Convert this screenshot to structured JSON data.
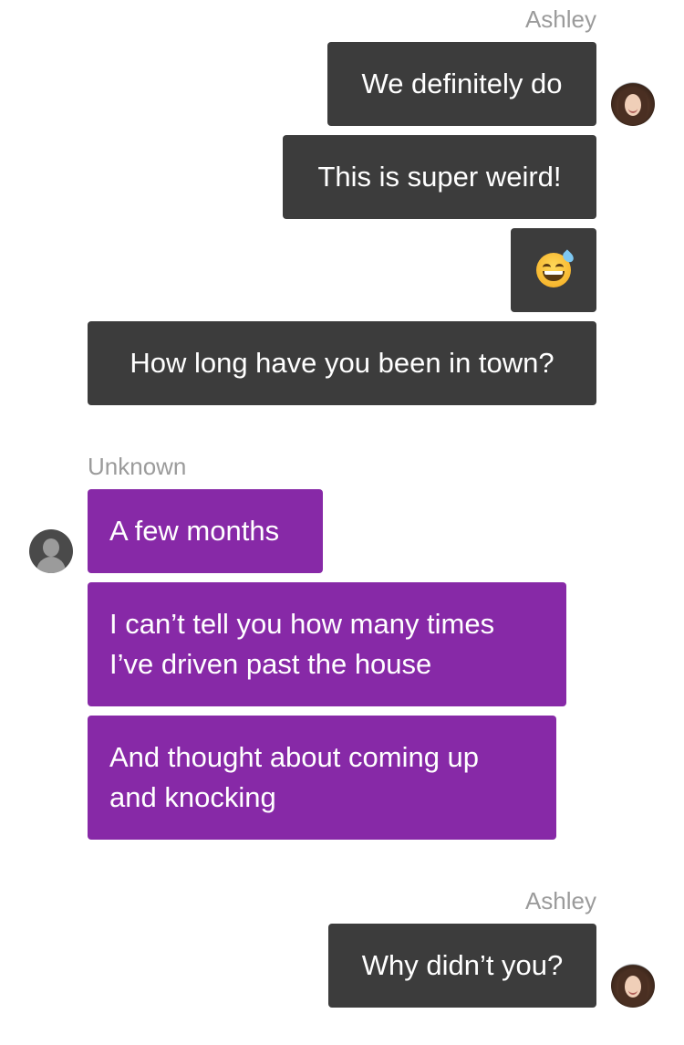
{
  "conversation": {
    "group1": {
      "sender": "Ashley",
      "messages": [
        "We definitely do",
        "This is super weird!",
        "😅",
        "How long have you been in town?"
      ]
    },
    "group2": {
      "sender": "Unknown",
      "messages": [
        "A few months",
        "I can’t tell you how many times\nI’ve driven past the house",
        "And thought about coming up\nand knocking"
      ]
    },
    "group3": {
      "sender": "Ashley",
      "messages": [
        "Why didn’t you?"
      ]
    }
  },
  "icons": {
    "emoji": "grinning-face-with-sweat-emoji",
    "ashley_avatar": "ashley-avatar-photo",
    "unknown_avatar": "default-user-avatar-icon"
  },
  "colors": {
    "ashley_bubble": "#3c3c3c",
    "unknown_bubble": "#8729a7",
    "bubble_text": "#ffffff",
    "sender_label": "#9b9b9b",
    "background": "#ffffff"
  }
}
